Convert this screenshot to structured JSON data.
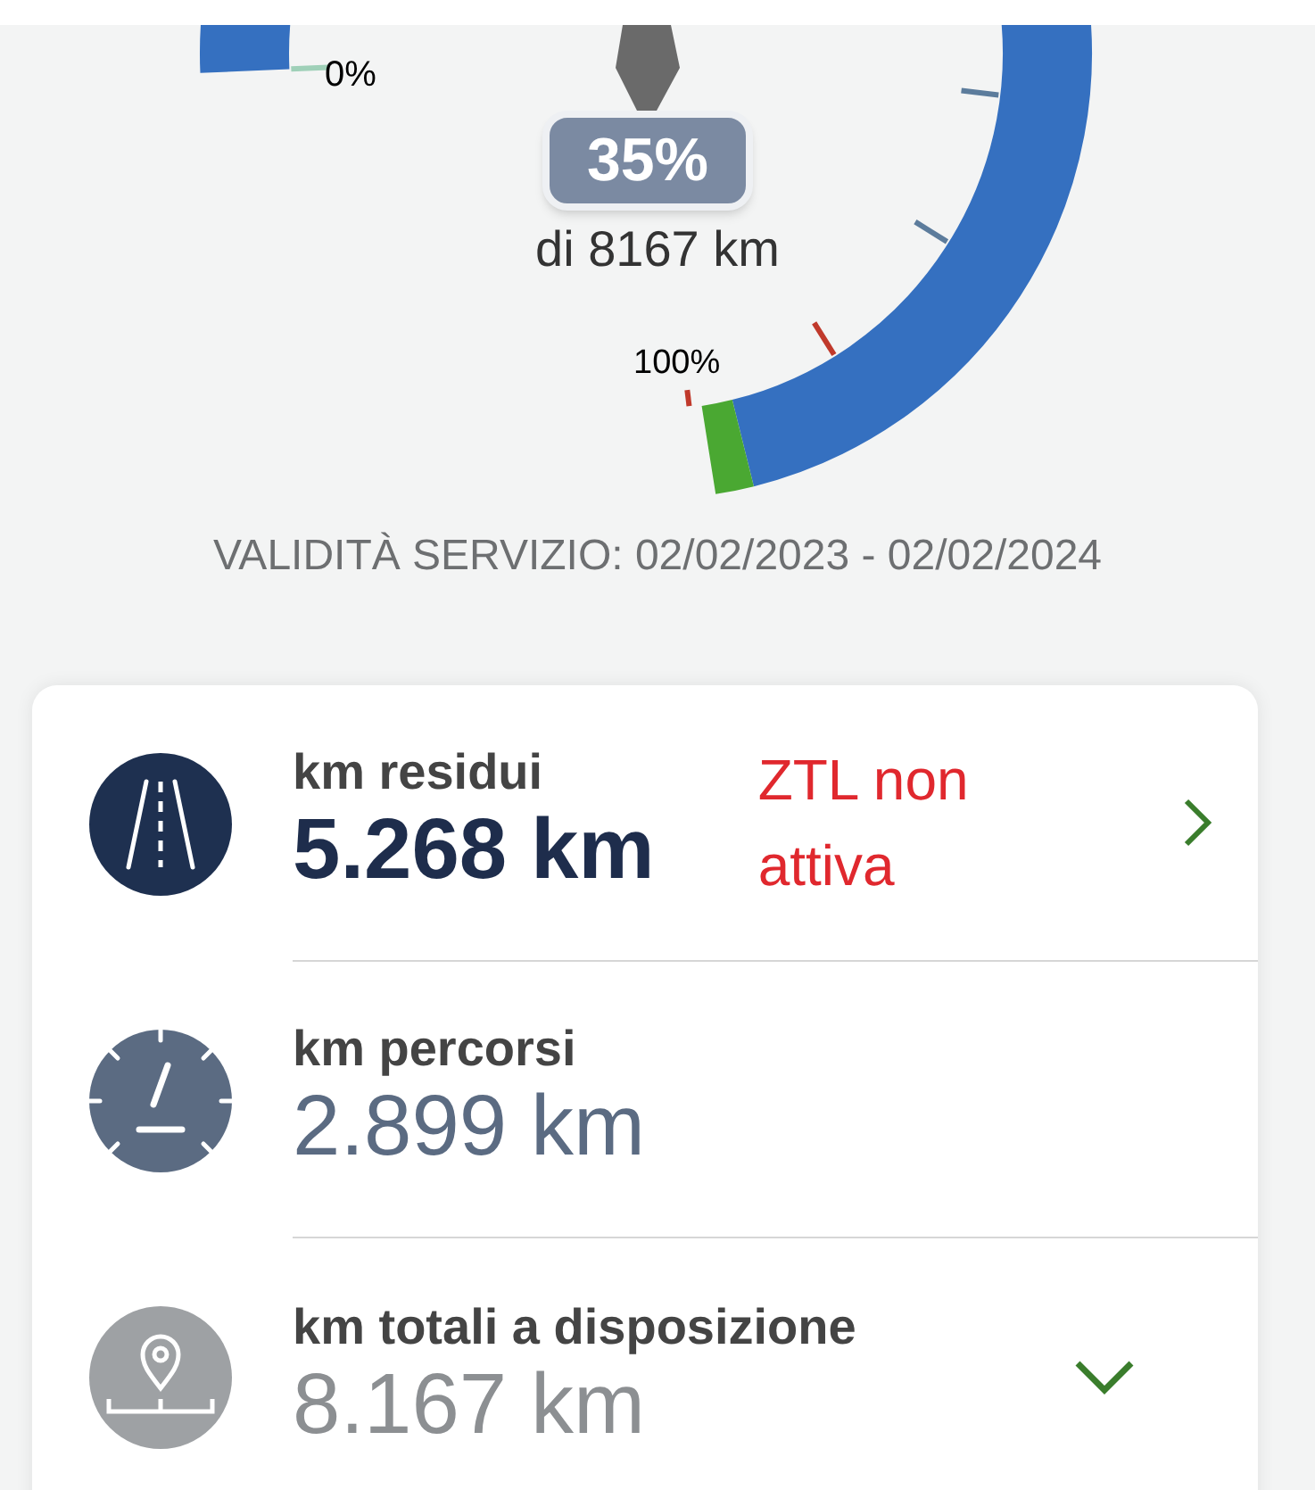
{
  "gauge": {
    "start_label": "0%",
    "end_label": "100%",
    "percent": "35%",
    "total": "di 8167 km"
  },
  "validity": "VALIDITÀ SERVIZIO: 02/02/2023 - 02/02/2024",
  "rows": [
    {
      "kind": "link",
      "label": "km residui",
      "value": "5.268 km",
      "status": "ZTL non attiva"
    },
    {
      "kind": "plain",
      "label": "km percorsi",
      "value": "2.899 km"
    },
    {
      "kind": "expandable",
      "label": "km totali a disposizione",
      "value": "8.167 km",
      "expanded": false
    }
  ]
}
